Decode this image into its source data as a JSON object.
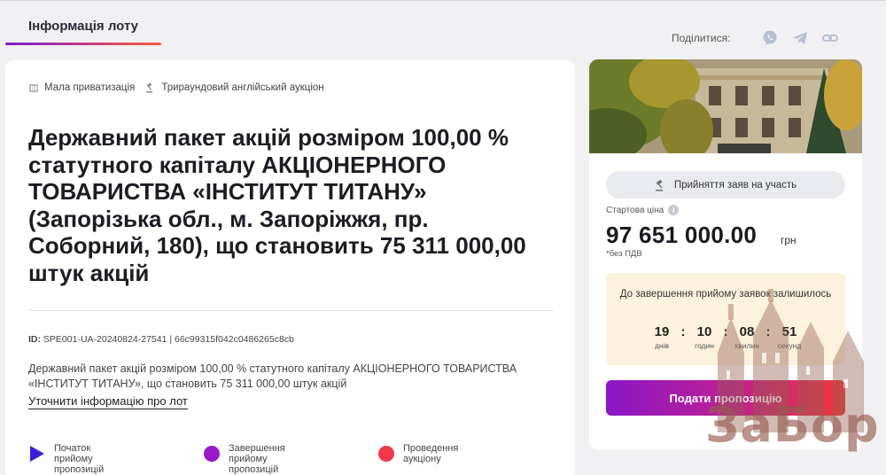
{
  "tabs": [
    {
      "label": "Інформація лоту",
      "active": true
    }
  ],
  "share": {
    "label": "Поділитися:",
    "icons": [
      "viber-icon",
      "telegram-icon",
      "link-icon"
    ]
  },
  "lot": {
    "tags": [
      {
        "icon": "building-icon",
        "label": "Мала приватизація"
      },
      {
        "icon": "gavel-icon",
        "label": "Трираундовий англійський аукціон"
      }
    ],
    "title": "Державний пакет акцій розміром 100,00 % статутного капіталу АКЦІОНЕРНОГО ТОВАРИСТВА «ІНСТИТУТ ТИТАНУ» (Запорізька обл., м. Запоріжжя, пр. Соборний, 180), що становить 75 311 000,00 штук акцій",
    "id_label": "ID:",
    "id_value": "SPE001-UA-20240824-27541 | 66c99315f042c0486265c8cb",
    "description": "Державний пакет акцій розміром 100,00 % статутного капіталу АКЦІОНЕРНОГО ТОВАРИСТВА «ІНСТИТУТ ТИТАНУ», що становить 75 311 000,00 штук акцій",
    "details_link": "Уточнити інформацію про лот"
  },
  "stages": [
    {
      "label": "Початок прийому пропозицій",
      "color": "#3b1fd8",
      "shape": "triangle"
    },
    {
      "label": "Завершення прийому пропозицій",
      "color": "#9a19c9",
      "shape": "circle"
    },
    {
      "label": "Проведення аукціону",
      "color": "#ee3a4a",
      "shape": "circle"
    }
  ],
  "sidebar": {
    "status_button": "Прийняття заяв на участь",
    "price_label": "Стартова ціна",
    "price": "97 651 000.00",
    "currency": "грн",
    "vat_note": "*без ПДВ",
    "timer_title": "До завершення прийому заявок залишилось",
    "timer": [
      {
        "value": "19",
        "unit": "днів"
      },
      {
        "value": "10",
        "unit": "годин"
      },
      {
        "value": "08",
        "unit": "хвилин"
      },
      {
        "value": "51",
        "unit": "секунд"
      }
    ],
    "offer_button": "Подати пропозицію"
  },
  "watermark": "ЗаБор",
  "colors": {
    "accent_gradient_start": "#8a17c7",
    "accent_gradient_end": "#f2373a",
    "timer_bg": "#fcf2dd"
  }
}
